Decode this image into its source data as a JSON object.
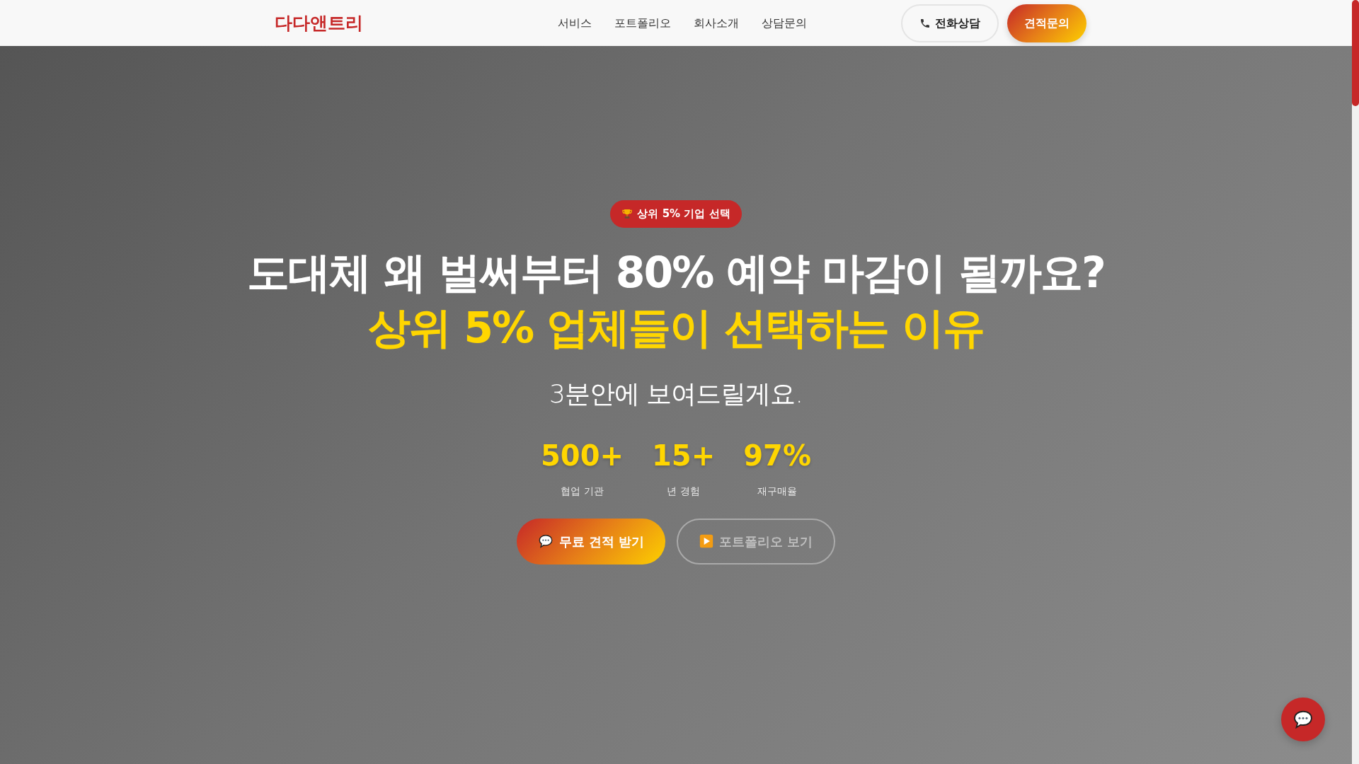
{
  "navbar": {
    "logo": "다다앤트리",
    "links": [
      {
        "label": "서비스"
      },
      {
        "label": "포트폴리오"
      },
      {
        "label": "회사소개"
      },
      {
        "label": "상담문의"
      }
    ],
    "buttons": [
      {
        "kind": "phone",
        "label": "전화상담"
      },
      {
        "kind": "primary",
        "label": "견적문의"
      }
    ]
  },
  "hero": {
    "badge": "상위 5% 기업 선택",
    "headline": "도대체 왜 벌써부터 80% 예약 마감이 될까요?",
    "highlight": "상위 5% 업체들이 선택하는 이유",
    "subtitle": "3분안에 보여드릴게요.",
    "stats": [
      {
        "value": "500+",
        "label": "협업 기관"
      },
      {
        "value": "15+",
        "label": "년 경험"
      },
      {
        "value": "97%",
        "label": "재구매율"
      }
    ],
    "buttons": [
      {
        "kind": "primary",
        "label": "무료 견적 받기"
      },
      {
        "kind": "outline",
        "label": "포트폴리오 보기"
      }
    ]
  }
}
